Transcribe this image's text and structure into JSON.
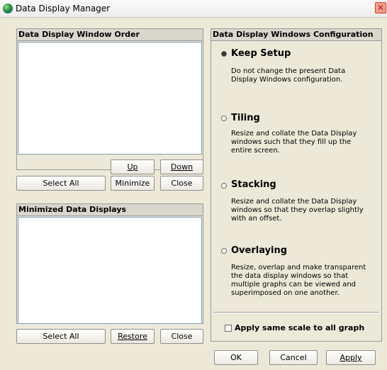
{
  "window": {
    "title": "Data Display Manager"
  },
  "left": {
    "order_header": "Data Display Window Order",
    "order_buttons": {
      "up": "Up",
      "down": "Down",
      "select_all": "Select All",
      "minimize": "Minimize",
      "close": "Close"
    },
    "minimized_header": "Minimized Data Displays",
    "minimized_buttons": {
      "select_all": "Select All",
      "restore": "Restore",
      "close": "Close"
    }
  },
  "config": {
    "header": "Data Display Windows Configuration",
    "options": [
      {
        "label": "Keep Setup",
        "selected": true,
        "description": "Do not change the present Data Display Windows configuration."
      },
      {
        "label": "Tiling",
        "selected": false,
        "description": "Resize and collate the Data Display windows such that they fill up the entire screen."
      },
      {
        "label": "Stacking",
        "selected": false,
        "description": "Resize and collate the Data Display windows so that they overlap slightly with an offset."
      },
      {
        "label": "Overlaying",
        "selected": false,
        "description": "Resize, overlap and make transparent the data display windows so that multiple graphs can be viewed and superimposed on one another."
      }
    ],
    "same_scale_label": "Apply same scale to all graph",
    "same_scale_checked": false
  },
  "footer": {
    "ok": "OK",
    "cancel": "Cancel",
    "apply": "Apply"
  }
}
